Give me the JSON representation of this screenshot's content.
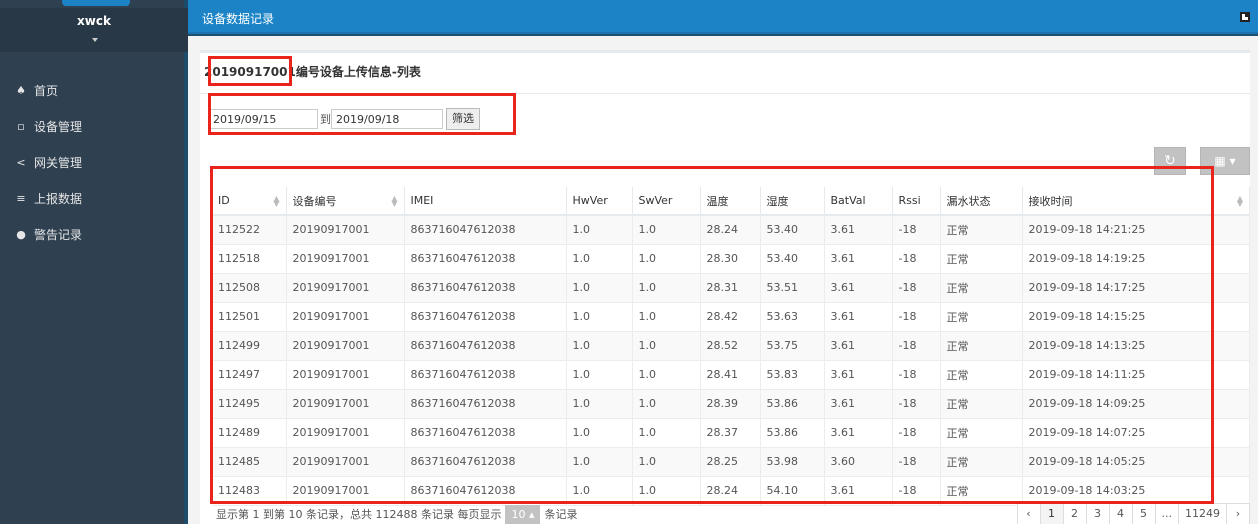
{
  "sidebar": {
    "username": "xwck",
    "items": [
      {
        "label": "首页",
        "icon": "home-icon",
        "glyph": "♠"
      },
      {
        "label": "设备管理",
        "icon": "device-icon",
        "glyph": "▫"
      },
      {
        "label": "网关管理",
        "icon": "share-icon",
        "glyph": "<"
      },
      {
        "label": "上报数据",
        "icon": "database-icon",
        "glyph": "≡"
      },
      {
        "label": "警告记录",
        "icon": "info-icon",
        "glyph": "●"
      }
    ]
  },
  "topbar": {
    "title": "设备数据记录"
  },
  "panel": {
    "title_id": "20190917001",
    "title_suffix": "编号设备上传信息-列表",
    "filter": {
      "start": "2019/09/15",
      "to": "到",
      "end": "2019/09/18",
      "button": "筛选"
    }
  },
  "table": {
    "headers": [
      "ID",
      "设备编号",
      "IMEI",
      "HwVer",
      "SwVer",
      "温度",
      "湿度",
      "BatVal",
      "Rssi",
      "漏水状态",
      "接收时间"
    ],
    "rows": [
      [
        "112522",
        "20190917001",
        "863716047612038",
        "1.0",
        "1.0",
        "28.24",
        "53.40",
        "3.61",
        "-18",
        "正常",
        "2019-09-18 14:21:25"
      ],
      [
        "112518",
        "20190917001",
        "863716047612038",
        "1.0",
        "1.0",
        "28.30",
        "53.40",
        "3.61",
        "-18",
        "正常",
        "2019-09-18 14:19:25"
      ],
      [
        "112508",
        "20190917001",
        "863716047612038",
        "1.0",
        "1.0",
        "28.31",
        "53.51",
        "3.61",
        "-18",
        "正常",
        "2019-09-18 14:17:25"
      ],
      [
        "112501",
        "20190917001",
        "863716047612038",
        "1.0",
        "1.0",
        "28.42",
        "53.63",
        "3.61",
        "-18",
        "正常",
        "2019-09-18 14:15:25"
      ],
      [
        "112499",
        "20190917001",
        "863716047612038",
        "1.0",
        "1.0",
        "28.52",
        "53.75",
        "3.61",
        "-18",
        "正常",
        "2019-09-18 14:13:25"
      ],
      [
        "112497",
        "20190917001",
        "863716047612038",
        "1.0",
        "1.0",
        "28.41",
        "53.83",
        "3.61",
        "-18",
        "正常",
        "2019-09-18 14:11:25"
      ],
      [
        "112495",
        "20190917001",
        "863716047612038",
        "1.0",
        "1.0",
        "28.39",
        "53.86",
        "3.61",
        "-18",
        "正常",
        "2019-09-18 14:09:25"
      ],
      [
        "112489",
        "20190917001",
        "863716047612038",
        "1.0",
        "1.0",
        "28.37",
        "53.86",
        "3.61",
        "-18",
        "正常",
        "2019-09-18 14:07:25"
      ],
      [
        "112485",
        "20190917001",
        "863716047612038",
        "1.0",
        "1.0",
        "28.25",
        "53.98",
        "3.60",
        "-18",
        "正常",
        "2019-09-18 14:05:25"
      ],
      [
        "112483",
        "20190917001",
        "863716047612038",
        "1.0",
        "1.0",
        "28.24",
        "54.10",
        "3.61",
        "-18",
        "正常",
        "2019-09-18 14:03:25"
      ]
    ]
  },
  "footer": {
    "info_before": "显示第 1 到第 10 条记录，总共 112488 条记录 每页显示",
    "page_size": "10 ▴",
    "info_after": "条记录",
    "pages": [
      "‹",
      "1",
      "2",
      "3",
      "4",
      "5",
      "...",
      "11249",
      "›"
    ]
  },
  "colors": {
    "accent": "#1c84c6",
    "sidebar": "#2f4050",
    "annotation": "#e8241b"
  }
}
